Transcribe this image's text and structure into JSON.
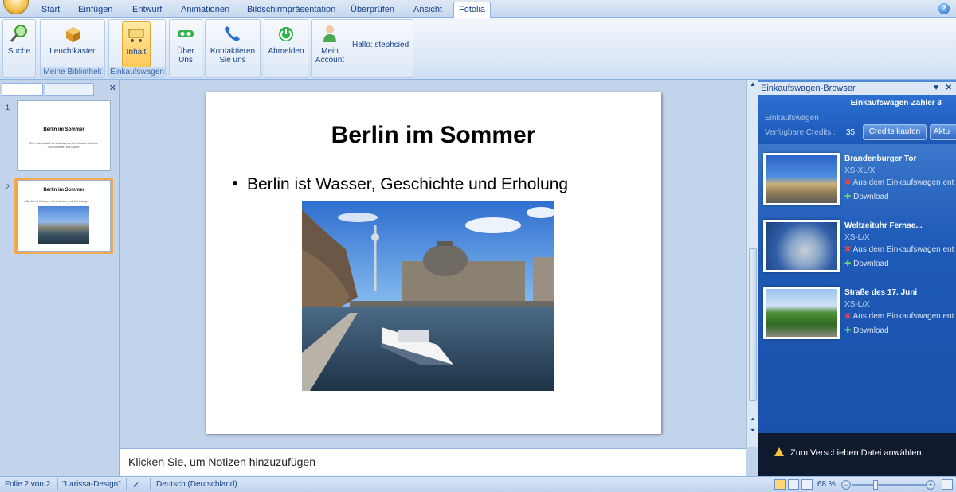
{
  "tabs": [
    "Start",
    "Einfügen",
    "Entwurf",
    "Animationen",
    "Bildschirmpräsentation",
    "Überprüfen",
    "Ansicht",
    "Fotolia"
  ],
  "active_tab": "Fotolia",
  "ribbon": {
    "search": "Suche",
    "lightbox": "Leuchtkasten",
    "group_library": "Meine Bibliothek",
    "content": "Inhalt",
    "group_cart": "Einkaufswagen",
    "about_line1": "Über",
    "about_line2": "Uns",
    "contact_line1": "Kontaktieren",
    "contact_line2": "Sie uns",
    "logout": "Abmelden",
    "account_line1": "Mein",
    "account_line2": "Account",
    "greeting": "Hallo: stephsied"
  },
  "thumbnails": [
    {
      "num": "1",
      "title": "Berlin im Sommer",
      "body": "Die Hauptstadt Deutschlands ist bekannt für ihre Geschichte und Kultur"
    },
    {
      "num": "2",
      "title": "Berlin im Sommer",
      "body": "• Berlin ist Wasser, Geschichte und Erholung"
    }
  ],
  "slide": {
    "title": "Berlin im Sommer",
    "bullet": "Berlin ist Wasser, Geschichte und Erholung"
  },
  "notes_placeholder": "Klicken Sie, um  Notizen hinzuzufügen",
  "cart_panel": {
    "title": "Einkaufswagen-Browser",
    "counter": "Einkaufswagen-Zähler 3",
    "cart_label": "Einkaufswagen",
    "credits_label": "Verfügbare Credits :",
    "credits_value": "35",
    "buy_credits": "Credits kaufen",
    "update": "Aktu",
    "items": [
      {
        "name": "Brandenburger Tor",
        "size": "XS-XL/X",
        "remove": "Aus dem Einkaufswagen ent",
        "download": "Download"
      },
      {
        "name": "Weltzeituhr Fernse...",
        "size": "XS-L/X",
        "remove": "Aus dem Einkaufswagen ent",
        "download": "Download"
      },
      {
        "name": "Straße des 17. Juni",
        "size": "XS-L/X",
        "remove": "Aus dem Einkaufswagen ent",
        "download": "Download"
      }
    ],
    "warning": "Zum Verschieben Datei anwählen."
  },
  "status": {
    "slide": "Folie 2 von 2",
    "design": "\"Larissa-Design\"",
    "language": "Deutsch (Deutschland)",
    "zoom": "68 %"
  },
  "colors": {
    "accent": "#f6a94c",
    "ribbon_text": "#15428b",
    "panel_blue": "#1f5bb9"
  }
}
